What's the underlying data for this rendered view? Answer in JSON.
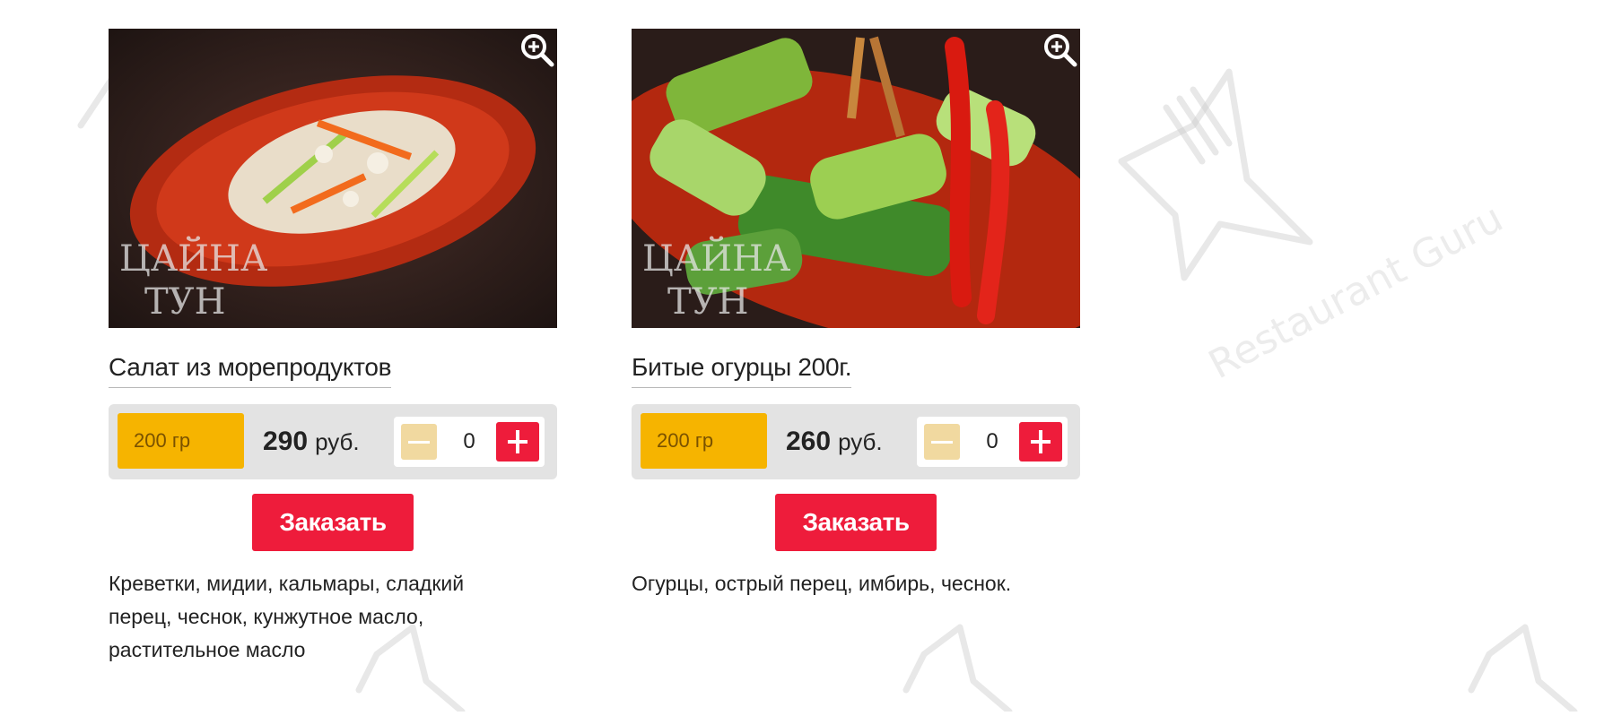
{
  "watermark": {
    "brand": "Restaurant Guru",
    "logo_text": "ЦАЙНА ТУН"
  },
  "items": [
    {
      "title": "Салат из морепродуктов",
      "weight": "200 гр",
      "price_value": "290",
      "price_unit": "руб.",
      "quantity": "0",
      "order_label": "Заказать",
      "description": "Креветки, мидии, кальмары, сладкий перец, чеснок, кунжутное масло, растительное масло"
    },
    {
      "title": "Битые огурцы 200г.",
      "weight": "200 гр",
      "price_value": "260",
      "price_unit": "руб.",
      "quantity": "0",
      "order_label": "Заказать",
      "description": "Огурцы, острый перец, имбирь, чеснок."
    }
  ],
  "colors": {
    "accent_red": "#ee1c3b",
    "weight_yellow": "#f6b400",
    "minus_beige": "#f1d9a0",
    "bar_gray": "#e3e3e3"
  },
  "icons": {
    "zoom": "zoom-in-icon",
    "minus": "minus-icon",
    "plus": "plus-icon"
  }
}
